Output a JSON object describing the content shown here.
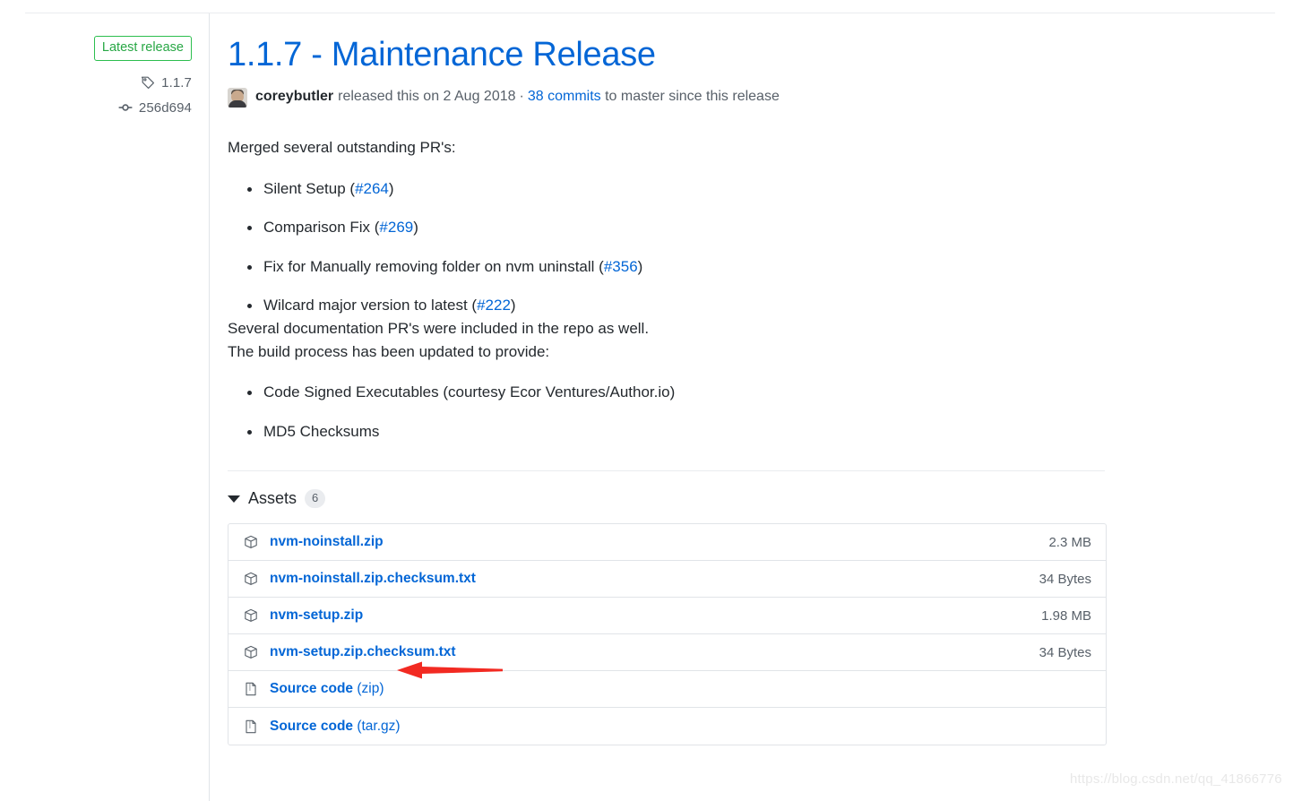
{
  "sidebar": {
    "badge_label": "Latest release",
    "badge_color": "#2cbe4e",
    "tag_icon": "tag-icon",
    "tag_value": "1.1.7",
    "commit_icon": "commit-icon",
    "commit_value": "256d694"
  },
  "release": {
    "title": "1.1.7 - Maintenance Release",
    "title_color": "#0366d6",
    "avatar": "author-avatar",
    "author": "coreybutler",
    "released_text": "released this on 2 Aug 2018",
    "separator": "·",
    "commits_link": "38 commits",
    "commits_suffix": "to master since this release"
  },
  "body": {
    "intro": "Merged several outstanding PR's:",
    "pr_list": [
      {
        "text": "Silent Setup (",
        "ref": "#264",
        "close": ")"
      },
      {
        "text": "Comparison Fix (",
        "ref": "#269",
        "close": ")"
      },
      {
        "text": "Fix for Manually removing folder on nvm uninstall (",
        "ref": "#356",
        "close": ")"
      },
      {
        "text": "Wilcard major version to latest (",
        "ref": "#222",
        "close": ")"
      }
    ],
    "para_docs": "Several documentation PR's were included in the repo as well.",
    "para_build": "The build process has been updated to provide:",
    "build_list": [
      "Code Signed Executables (courtesy Ecor Ventures/Author.io)",
      "MD5 Checksums"
    ]
  },
  "assets": {
    "caret": "caret-down-icon",
    "label": "Assets",
    "count": "6",
    "rows": [
      {
        "icon": "package-icon",
        "name": "nvm-noinstall.zip",
        "suffix": "",
        "size": "2.3 MB"
      },
      {
        "icon": "package-icon",
        "name": "nvm-noinstall.zip.checksum.txt",
        "suffix": "",
        "size": "34 Bytes"
      },
      {
        "icon": "package-icon",
        "name": "nvm-setup.zip",
        "suffix": "",
        "size": "1.98 MB"
      },
      {
        "icon": "package-icon",
        "name": "nvm-setup.zip.checksum.txt",
        "suffix": "",
        "size": "34 Bytes"
      },
      {
        "icon": "file-zip-icon",
        "name": "Source code",
        "suffix": " (zip)",
        "size": ""
      },
      {
        "icon": "file-zip-icon",
        "name": "Source code",
        "suffix": " (tar.gz)",
        "size": ""
      }
    ]
  },
  "annotation": {
    "arrow": "red-arrow-pointing-left",
    "arrow_color": "#f22a22",
    "target": "nvm-setup.zip"
  },
  "watermark": {
    "text": "https://blog.csdn.net/qq_41866776"
  }
}
